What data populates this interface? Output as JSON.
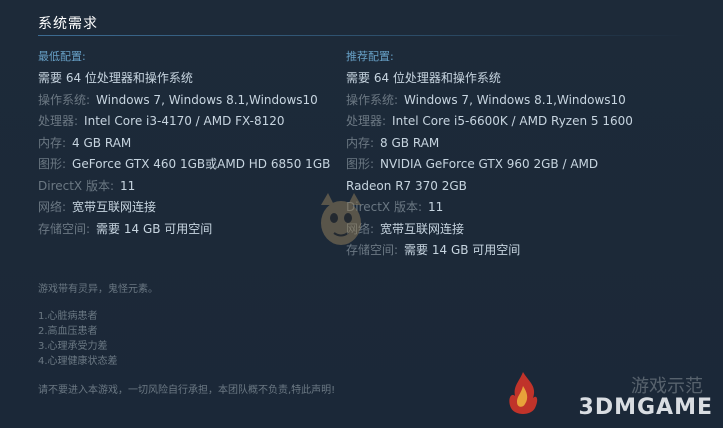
{
  "title": "系统需求",
  "minimum": {
    "heading": "最低配置:",
    "rows": [
      {
        "k": "",
        "v": "需要 64 位处理器和操作系统"
      },
      {
        "k": "操作系统:",
        "v": "Windows 7, Windows 8.1,Windows10"
      },
      {
        "k": "处理器:",
        "v": "Intel Core i3-4170 / AMD FX-8120"
      },
      {
        "k": "内存:",
        "v": "4 GB RAM"
      },
      {
        "k": "图形:",
        "v": "GeForce GTX 460 1GB或AMD HD 6850 1GB"
      },
      {
        "k": "DirectX 版本:",
        "v": "11"
      },
      {
        "k": "网络:",
        "v": "宽带互联网连接"
      },
      {
        "k": "存储空间:",
        "v": "需要 14 GB 可用空间"
      }
    ]
  },
  "recommended": {
    "heading": "推荐配置:",
    "rows": [
      {
        "k": "",
        "v": "需要 64 位处理器和操作系统"
      },
      {
        "k": "操作系统:",
        "v": "Windows 7, Windows 8.1,Windows10"
      },
      {
        "k": "处理器:",
        "v": "Intel Core i5-6600K / AMD Ryzen 5 1600"
      },
      {
        "k": "内存:",
        "v": "8 GB RAM"
      },
      {
        "k": "图形:",
        "v": "NVIDIA GeForce GTX 960 2GB / AMD Radeon R7 370 2GB"
      },
      {
        "k": "DirectX 版本:",
        "v": "11"
      },
      {
        "k": "网络:",
        "v": "宽带互联网连接"
      },
      {
        "k": "存储空间:",
        "v": "需要 14 GB 可用空间"
      }
    ]
  },
  "notes": {
    "intro": "游戏带有灵异，鬼怪元素。",
    "items": [
      "1.心脏病患者",
      "2.高血压患者",
      "3.心理承受力差",
      "4.心理健康状态差"
    ],
    "disclaimer": "请不要进入本游戏，一切风险自行承担，本团队概不负责,特此声明!"
  },
  "watermark": {
    "logo": "3DMGAME",
    "cn": "游戏示范"
  }
}
